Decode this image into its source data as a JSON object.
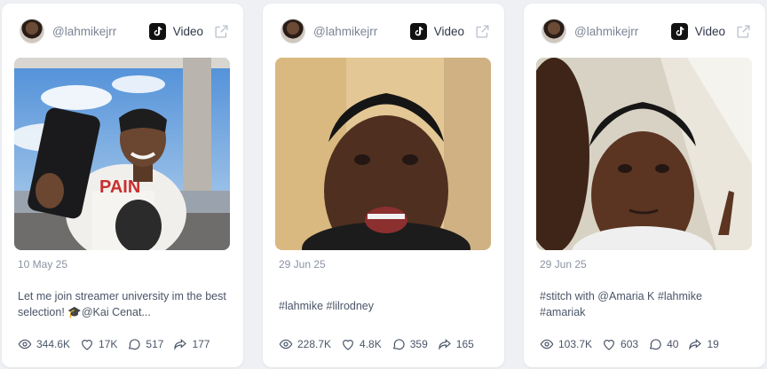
{
  "cards": [
    {
      "username": "@lahmikejrr",
      "platform_label": "Video",
      "date": "10 May 25",
      "caption": "Let me join streamer university im the best selection! 🎓@Kai Cenat...",
      "stats": {
        "views": "344.6K",
        "likes": "17K",
        "comments": "517",
        "shares": "177"
      }
    },
    {
      "username": "@lahmikejrr",
      "platform_label": "Video",
      "date": "29 Jun 25",
      "caption": "#lahmike #lilrodney",
      "stats": {
        "views": "228.7K",
        "likes": "4.8K",
        "comments": "359",
        "shares": "165"
      }
    },
    {
      "username": "@lahmikejrr",
      "platform_label": "Video",
      "date": "29 Jun 25",
      "caption": "#stitch with @Amaria K #lahmike #amariak",
      "stats": {
        "views": "103.7K",
        "likes": "603",
        "comments": "40",
        "shares": "19"
      }
    }
  ],
  "icons": {
    "platform": "tiktok-icon",
    "external": "external-link-icon",
    "views": "eye-icon",
    "likes": "heart-icon",
    "comments": "comment-icon",
    "shares": "share-icon"
  }
}
